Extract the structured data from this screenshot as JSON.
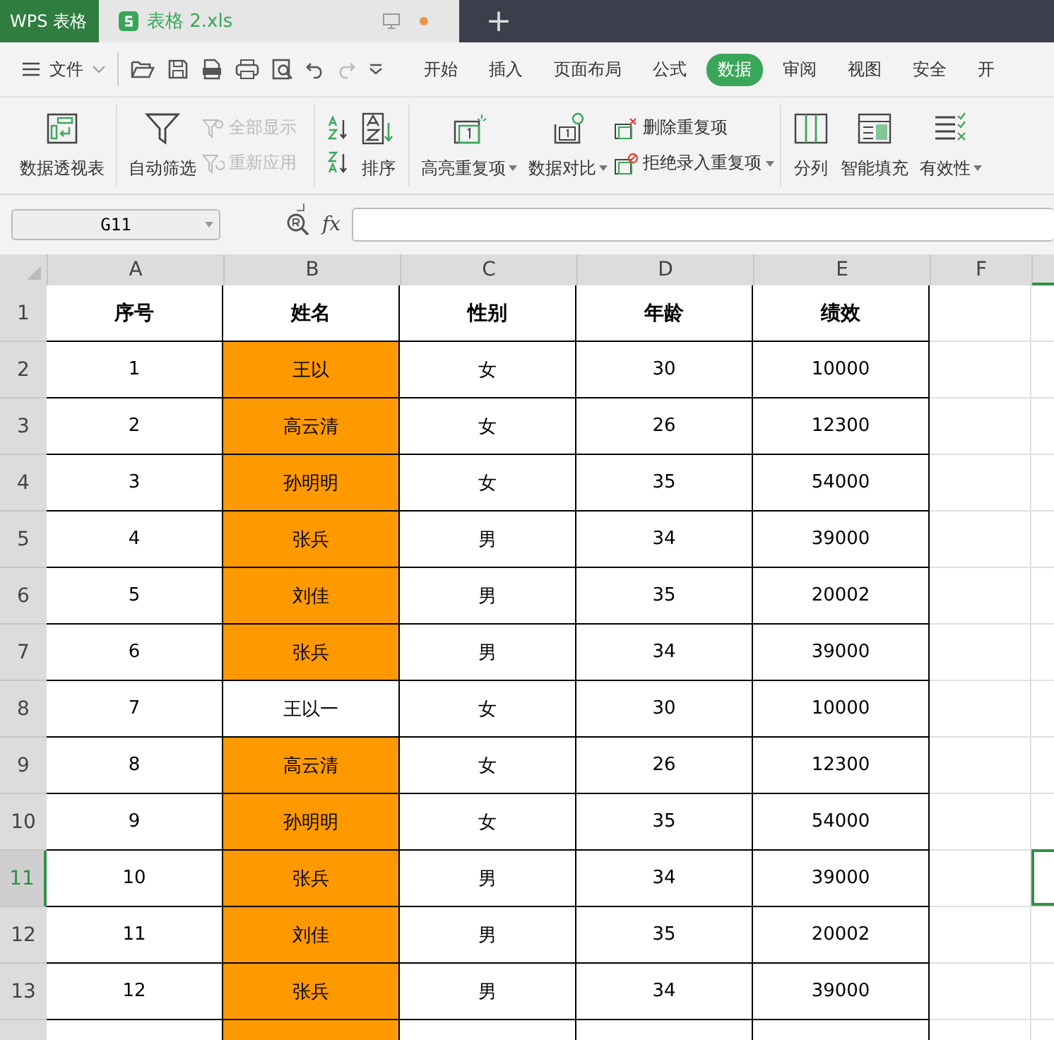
{
  "title_bar": {
    "app_tab": "WPS 表格",
    "doc_tab": {
      "label": "表格 2.xls",
      "unsaved": true
    },
    "new_tab": "+"
  },
  "menu": {
    "file": "文件",
    "tabs": [
      {
        "label": "开始",
        "selected": false
      },
      {
        "label": "插入",
        "selected": false
      },
      {
        "label": "页面布局",
        "selected": false
      },
      {
        "label": "公式",
        "selected": false
      },
      {
        "label": "数据",
        "selected": true
      },
      {
        "label": "审阅",
        "selected": false
      },
      {
        "label": "视图",
        "selected": false
      },
      {
        "label": "安全",
        "selected": false
      },
      {
        "label": "开",
        "selected": false
      }
    ]
  },
  "ribbon": {
    "pivot": {
      "label": "数据透视表"
    },
    "filter": {
      "label": "自动筛选"
    },
    "show_all": {
      "label": "全部显示",
      "disabled": true
    },
    "reapply": {
      "label": "重新应用",
      "disabled": true
    },
    "sort": {
      "label": "排序"
    },
    "highlight_dupes": {
      "label": "高亮重复项",
      "dropdown": true
    },
    "compare": {
      "label": "数据对比",
      "dropdown": true
    },
    "remove_dupes": {
      "label": "删除重复项"
    },
    "reject_dupes": {
      "label": "拒绝录入重复项",
      "dropdown": true
    },
    "split": {
      "label": "分列"
    },
    "smart_fill": {
      "label": "智能填充"
    },
    "validity": {
      "label": "有效性",
      "dropdown": true
    }
  },
  "formula_bar": {
    "cell_ref": "G11",
    "fx": "fx"
  },
  "sheet": {
    "columns": [
      "A",
      "B",
      "C",
      "D",
      "E",
      "F"
    ],
    "rows": [
      {
        "number": "1",
        "kind": "header",
        "selected": false,
        "cells": [
          {
            "text": "序号",
            "highlighted": false
          },
          {
            "text": "姓名",
            "highlighted": false
          },
          {
            "text": "性别",
            "highlighted": false
          },
          {
            "text": "年龄",
            "highlighted": false
          },
          {
            "text": "绩效",
            "highlighted": false
          }
        ]
      },
      {
        "number": "2",
        "kind": "data",
        "selected": false,
        "cells": [
          {
            "text": "1",
            "highlighted": false
          },
          {
            "text": "王以",
            "highlighted": true
          },
          {
            "text": "女",
            "highlighted": false
          },
          {
            "text": "30",
            "highlighted": false
          },
          {
            "text": "10000",
            "highlighted": false
          }
        ]
      },
      {
        "number": "3",
        "kind": "data",
        "selected": false,
        "cells": [
          {
            "text": "2",
            "highlighted": false
          },
          {
            "text": "高云清",
            "highlighted": true
          },
          {
            "text": "女",
            "highlighted": false
          },
          {
            "text": "26",
            "highlighted": false
          },
          {
            "text": "12300",
            "highlighted": false
          }
        ]
      },
      {
        "number": "4",
        "kind": "data",
        "selected": false,
        "cells": [
          {
            "text": "3",
            "highlighted": false
          },
          {
            "text": "孙明明",
            "highlighted": true
          },
          {
            "text": "女",
            "highlighted": false
          },
          {
            "text": "35",
            "highlighted": false
          },
          {
            "text": "54000",
            "highlighted": false
          }
        ]
      },
      {
        "number": "5",
        "kind": "data",
        "selected": false,
        "cells": [
          {
            "text": "4",
            "highlighted": false
          },
          {
            "text": "张兵",
            "highlighted": true
          },
          {
            "text": "男",
            "highlighted": false
          },
          {
            "text": "34",
            "highlighted": false
          },
          {
            "text": "39000",
            "highlighted": false
          }
        ]
      },
      {
        "number": "6",
        "kind": "data",
        "selected": false,
        "cells": [
          {
            "text": "5",
            "highlighted": false
          },
          {
            "text": "刘佳",
            "highlighted": true
          },
          {
            "text": "男",
            "highlighted": false
          },
          {
            "text": "35",
            "highlighted": false
          },
          {
            "text": "20002",
            "highlighted": false
          }
        ]
      },
      {
        "number": "7",
        "kind": "data",
        "selected": false,
        "cells": [
          {
            "text": "6",
            "highlighted": false
          },
          {
            "text": "张兵",
            "highlighted": true
          },
          {
            "text": "男",
            "highlighted": false
          },
          {
            "text": "34",
            "highlighted": false
          },
          {
            "text": "39000",
            "highlighted": false
          }
        ]
      },
      {
        "number": "8",
        "kind": "data",
        "selected": false,
        "cells": [
          {
            "text": "7",
            "highlighted": false
          },
          {
            "text": "王以一",
            "highlighted": false
          },
          {
            "text": "女",
            "highlighted": false
          },
          {
            "text": "30",
            "highlighted": false
          },
          {
            "text": "10000",
            "highlighted": false
          }
        ]
      },
      {
        "number": "9",
        "kind": "data",
        "selected": false,
        "cells": [
          {
            "text": "8",
            "highlighted": false
          },
          {
            "text": "高云清",
            "highlighted": true
          },
          {
            "text": "女",
            "highlighted": false
          },
          {
            "text": "26",
            "highlighted": false
          },
          {
            "text": "12300",
            "highlighted": false
          }
        ]
      },
      {
        "number": "10",
        "kind": "data",
        "selected": false,
        "cells": [
          {
            "text": "9",
            "highlighted": false
          },
          {
            "text": "孙明明",
            "highlighted": true
          },
          {
            "text": "女",
            "highlighted": false
          },
          {
            "text": "35",
            "highlighted": false
          },
          {
            "text": "54000",
            "highlighted": false
          }
        ]
      },
      {
        "number": "11",
        "kind": "data",
        "selected": true,
        "cells": [
          {
            "text": "10",
            "highlighted": false
          },
          {
            "text": "张兵",
            "highlighted": true
          },
          {
            "text": "男",
            "highlighted": false
          },
          {
            "text": "34",
            "highlighted": false
          },
          {
            "text": "39000",
            "highlighted": false
          }
        ]
      },
      {
        "number": "12",
        "kind": "data",
        "selected": false,
        "cells": [
          {
            "text": "11",
            "highlighted": false
          },
          {
            "text": "刘佳",
            "highlighted": true
          },
          {
            "text": "男",
            "highlighted": false
          },
          {
            "text": "35",
            "highlighted": false
          },
          {
            "text": "20002",
            "highlighted": false
          }
        ]
      },
      {
        "number": "13",
        "kind": "data",
        "selected": false,
        "cells": [
          {
            "text": "12",
            "highlighted": false
          },
          {
            "text": "张兵",
            "highlighted": true
          },
          {
            "text": "男",
            "highlighted": false
          },
          {
            "text": "34",
            "highlighted": false
          },
          {
            "text": "39000",
            "highlighted": false
          }
        ]
      }
    ],
    "next_row_cells": [
      {
        "highlighted": false
      },
      {
        "highlighted": true
      },
      {
        "highlighted": false
      },
      {
        "highlighted": false
      },
      {
        "highlighted": false
      }
    ]
  }
}
